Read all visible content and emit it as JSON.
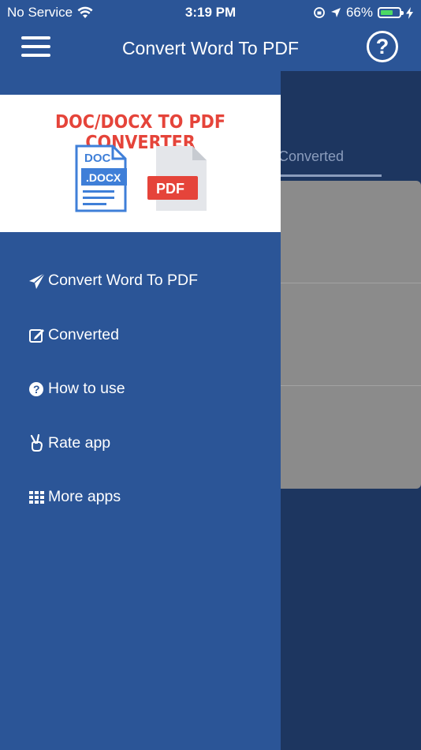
{
  "status_bar": {
    "carrier": "No Service",
    "time": "3:19 PM",
    "battery_percent": "66%",
    "battery_level": 0.66
  },
  "nav": {
    "title": "Convert Word To PDF",
    "menu_icon": "hamburger-icon",
    "help_icon": "help-circle-icon",
    "help_glyph": "?"
  },
  "drawer": {
    "logo_title": "DOC/DOCX TO PDF CONVERTER",
    "doc_label": "DOC",
    "docx_label": ".DOCX",
    "pdf_label": "PDF",
    "items": [
      {
        "label": "Convert Word To PDF",
        "icon": "paper-plane-icon"
      },
      {
        "label": "Converted",
        "icon": "edit-icon"
      },
      {
        "label": "How to use",
        "icon": "question-circle-icon"
      },
      {
        "label": "Rate app",
        "icon": "victory-hand-icon"
      },
      {
        "label": "More apps",
        "icon": "grid-icon"
      }
    ]
  },
  "background": {
    "tab_label": "Converted"
  },
  "colors": {
    "primary": "#2b5597",
    "dim_background": "#1d3660",
    "accent_red": "#e5443a",
    "doc_blue": "#3f7fd8",
    "battery_green": "#4cd964"
  }
}
